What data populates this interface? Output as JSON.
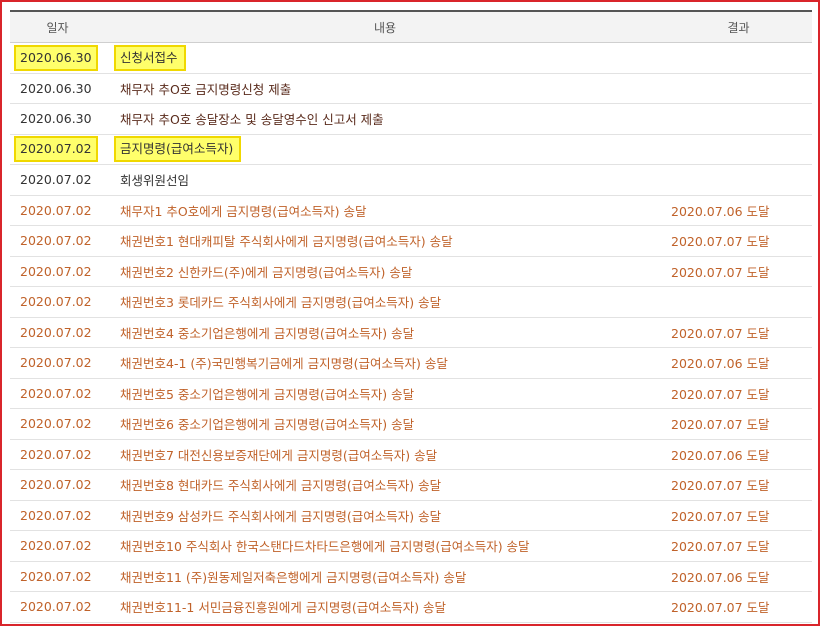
{
  "header": {
    "date": "일자",
    "content": "내용",
    "result": "결과"
  },
  "rows": [
    {
      "date": "2020.06.30",
      "content": "신청서접수",
      "result": ""
    },
    {
      "date": "2020.06.30",
      "content": "채무자 추O호 금지명령신청 제출",
      "result": ""
    },
    {
      "date": "2020.06.30",
      "content": "채무자 추O호 송달장소 및 송달영수인 신고서 제출",
      "result": ""
    },
    {
      "date": "2020.07.02",
      "content": "금지명령(급여소득자)",
      "result": ""
    },
    {
      "date": "2020.07.02",
      "content": "회생위원선임",
      "result": ""
    },
    {
      "date": "2020.07.02",
      "content": "채무자1 추O호에게 금지명령(급여소득자) 송달",
      "result": "2020.07.06 도달"
    },
    {
      "date": "2020.07.02",
      "content": "채권번호1 현대캐피탈 주식회사에게 금지명령(급여소득자) 송달",
      "result": "2020.07.07 도달"
    },
    {
      "date": "2020.07.02",
      "content": "채권번호2 신한카드(주)에게 금지명령(급여소득자) 송달",
      "result": "2020.07.07 도달"
    },
    {
      "date": "2020.07.02",
      "content": "채권번호3 롯데카드 주식회사에게 금지명령(급여소득자) 송달",
      "result": ""
    },
    {
      "date": "2020.07.02",
      "content": "채권번호4 중소기업은행에게 금지명령(급여소득자) 송달",
      "result": "2020.07.07 도달"
    },
    {
      "date": "2020.07.02",
      "content": "채권번호4-1 (주)국민행복기금에게 금지명령(급여소득자) 송달",
      "result": "2020.07.06 도달"
    },
    {
      "date": "2020.07.02",
      "content": "채권번호5 중소기업은행에게 금지명령(급여소득자) 송달",
      "result": "2020.07.07 도달"
    },
    {
      "date": "2020.07.02",
      "content": "채권번호6 중소기업은행에게 금지명령(급여소득자) 송달",
      "result": "2020.07.07 도달"
    },
    {
      "date": "2020.07.02",
      "content": "채권번호7 대전신용보증재단에게 금지명령(급여소득자) 송달",
      "result": "2020.07.06 도달"
    },
    {
      "date": "2020.07.02",
      "content": "채권번호8 현대카드 주식회사에게 금지명령(급여소득자) 송달",
      "result": "2020.07.07 도달"
    },
    {
      "date": "2020.07.02",
      "content": "채권번호9 삼성카드 주식회사에게 금지명령(급여소득자) 송달",
      "result": "2020.07.07 도달"
    },
    {
      "date": "2020.07.02",
      "content": "채권번호10 주식회사 한국스탠다드차타드은행에게 금지명령(급여소득자) 송달",
      "result": "2020.07.07 도달"
    },
    {
      "date": "2020.07.02",
      "content": "채권번호11 (주)원동제일저축은행에게 금지명령(급여소득자) 송달",
      "result": "2020.07.06 도달"
    },
    {
      "date": "2020.07.02",
      "content": "채권번호11-1 서민금융진흥원에게 금지명령(급여소득자) 송달",
      "result": "2020.07.07 도달"
    }
  ],
  "colors": {
    "frame": "#d9252b",
    "highlight": "#ffff6b",
    "orange_text": "#c0622a"
  }
}
